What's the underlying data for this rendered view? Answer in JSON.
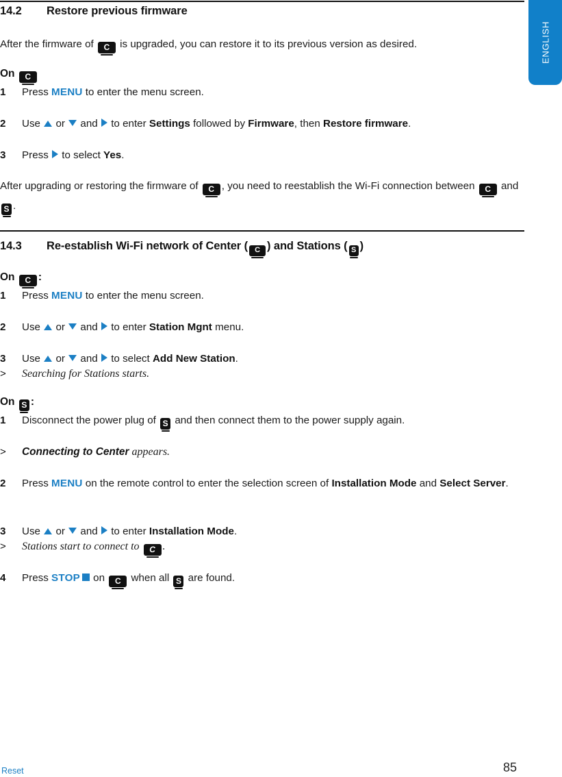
{
  "language_tab": {
    "label": "ENGLISH",
    "color": "#1180c9"
  },
  "colors": {
    "accent_blue": "#1b7fc4",
    "tab_blue": "#1180c9",
    "text": "#1a1a1a"
  },
  "sections": [
    {
      "number": "14.2",
      "title": "Restore previous firmware",
      "intro_a": "After the firmware of ",
      "intro_b": " is upgraded, you can restore it to its previous version as desired.",
      "on_label": "On",
      "steps": [
        {
          "marker": "1",
          "parts": [
            "Press ",
            "MENU",
            " to enter the menu screen."
          ]
        },
        {
          "marker": "2",
          "parts": [
            "Use ",
            " or ",
            " and ",
            " to enter ",
            "Settings",
            " followed by ",
            "Firmware",
            ", then ",
            "Restore firmware",
            "."
          ]
        },
        {
          "marker": "3",
          "parts": [
            "Press ",
            " to select ",
            "Yes",
            "."
          ]
        }
      ],
      "outro_a": "After upgrading or restoring the firmware of ",
      "outro_b": ", you need to reestablish the Wi-Fi connection between ",
      "outro_c": " and ",
      "outro_d": "."
    },
    {
      "number": "14.3",
      "title_a": "Re-establish Wi-Fi network of Center (",
      "title_b": ") and Stations (",
      "title_c": ")",
      "on_center_label": "On",
      "on_center_suffix": ":",
      "center_steps": [
        {
          "marker": "1",
          "parts": [
            "Press ",
            "MENU",
            " to enter the menu screen."
          ]
        },
        {
          "marker": "2",
          "parts": [
            "Use ",
            " or ",
            " and ",
            " to enter ",
            "Station Mgnt",
            " menu."
          ]
        },
        {
          "marker": "3",
          "parts": [
            "Use ",
            " or ",
            " and ",
            " to select ",
            "Add New Station",
            "."
          ]
        }
      ],
      "center_note": {
        "marker": ">",
        "text": "Searching for Stations starts."
      },
      "on_station_label": "On",
      "on_station_suffix": ":",
      "station_steps": [
        {
          "marker": "1",
          "parts": [
            "Disconnect the power plug of ",
            " and then connect them to the power supply again."
          ]
        }
      ],
      "station_note_bold": "Connecting to Center",
      "station_note_rest": " appears.",
      "station_note_marker": ">",
      "step2": {
        "marker": "2",
        "parts": [
          "Press ",
          "MENU",
          " on the remote control to enter the selection screen of ",
          "Installation Mode",
          " and ",
          "Select Server",
          "."
        ]
      },
      "step3": {
        "marker": "3",
        "parts": [
          "Use ",
          " or ",
          " and ",
          " to enter ",
          "Installation Mode",
          "."
        ]
      },
      "step3_note": {
        "marker": ">",
        "text_a": "Stations start to connect to ",
        "text_b": "."
      },
      "step4": {
        "marker": "4",
        "parts": [
          "Press ",
          "STOP",
          " on ",
          " when all ",
          " are found."
        ]
      }
    }
  ],
  "icons": {
    "center": "C",
    "station": "S",
    "arrow_up": "arrow-up-icon",
    "arrow_down": "arrow-down-icon",
    "arrow_right": "arrow-right-icon",
    "stop_square": "stop-square-icon"
  },
  "footer": {
    "left": "Reset",
    "page_number": "85"
  }
}
